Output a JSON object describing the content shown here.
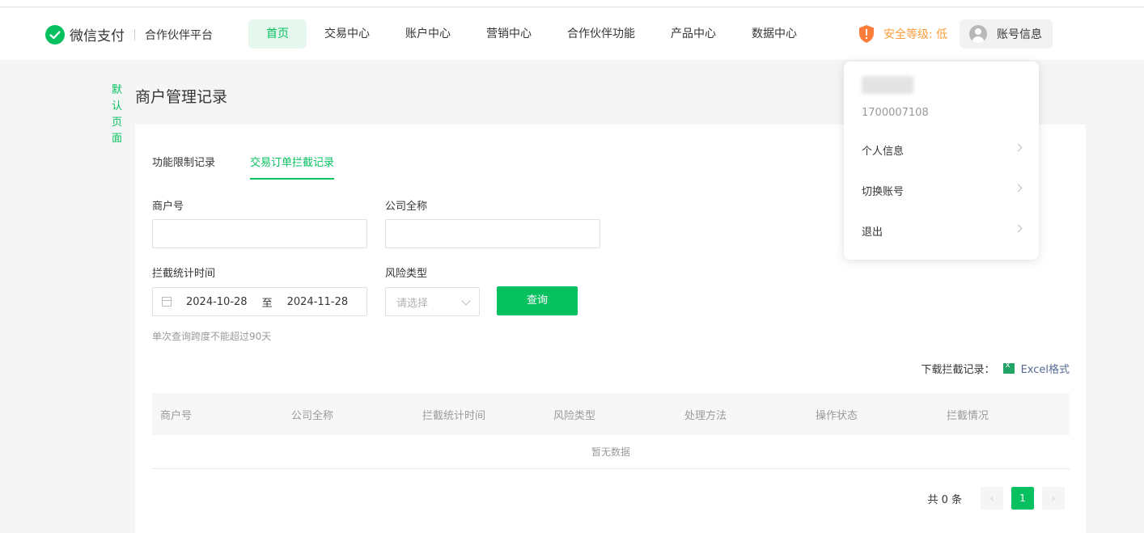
{
  "header": {
    "brand": "微信支付",
    "platform": "合作伙伴平台",
    "nav": [
      "首页",
      "交易中心",
      "账户中心",
      "营销中心",
      "合作伙伴功能",
      "产品中心",
      "数据中心"
    ],
    "security": "安全等级: 低",
    "account": "账号信息",
    "colors": {
      "accent": "#07c160",
      "warning": "#fa9d3b"
    }
  },
  "breadcrumb": "默认页面",
  "page_title": "商户管理记录",
  "tabs": [
    "功能限制记录",
    "交易订单拦截记录"
  ],
  "form": {
    "merchant_id_label": "商户号",
    "merchant_id_value": "",
    "company_label": "公司全称",
    "company_value": "",
    "time_label": "拦截统计时间",
    "date_start": "2024-10-28",
    "date_sep": "至",
    "date_end": "2024-11-28",
    "risk_label": "风险类型",
    "risk_placeholder": "请选择",
    "query_button": "查询",
    "hint": "单次查询跨度不能超过90天"
  },
  "download": {
    "label": "下载拦截记录：",
    "format": "Excel格式"
  },
  "table": {
    "columns": [
      "商户号",
      "公司全称",
      "拦截统计时间",
      "风险类型",
      "处理方法",
      "操作状态",
      "拦截情况"
    ],
    "empty": "暂无数据"
  },
  "pager": {
    "total": "共 0 条",
    "prev": "‹",
    "current": "1",
    "next": "›"
  },
  "account_menu": {
    "id": "1700007108",
    "items": [
      "个人信息",
      "切换账号",
      "退出"
    ]
  }
}
